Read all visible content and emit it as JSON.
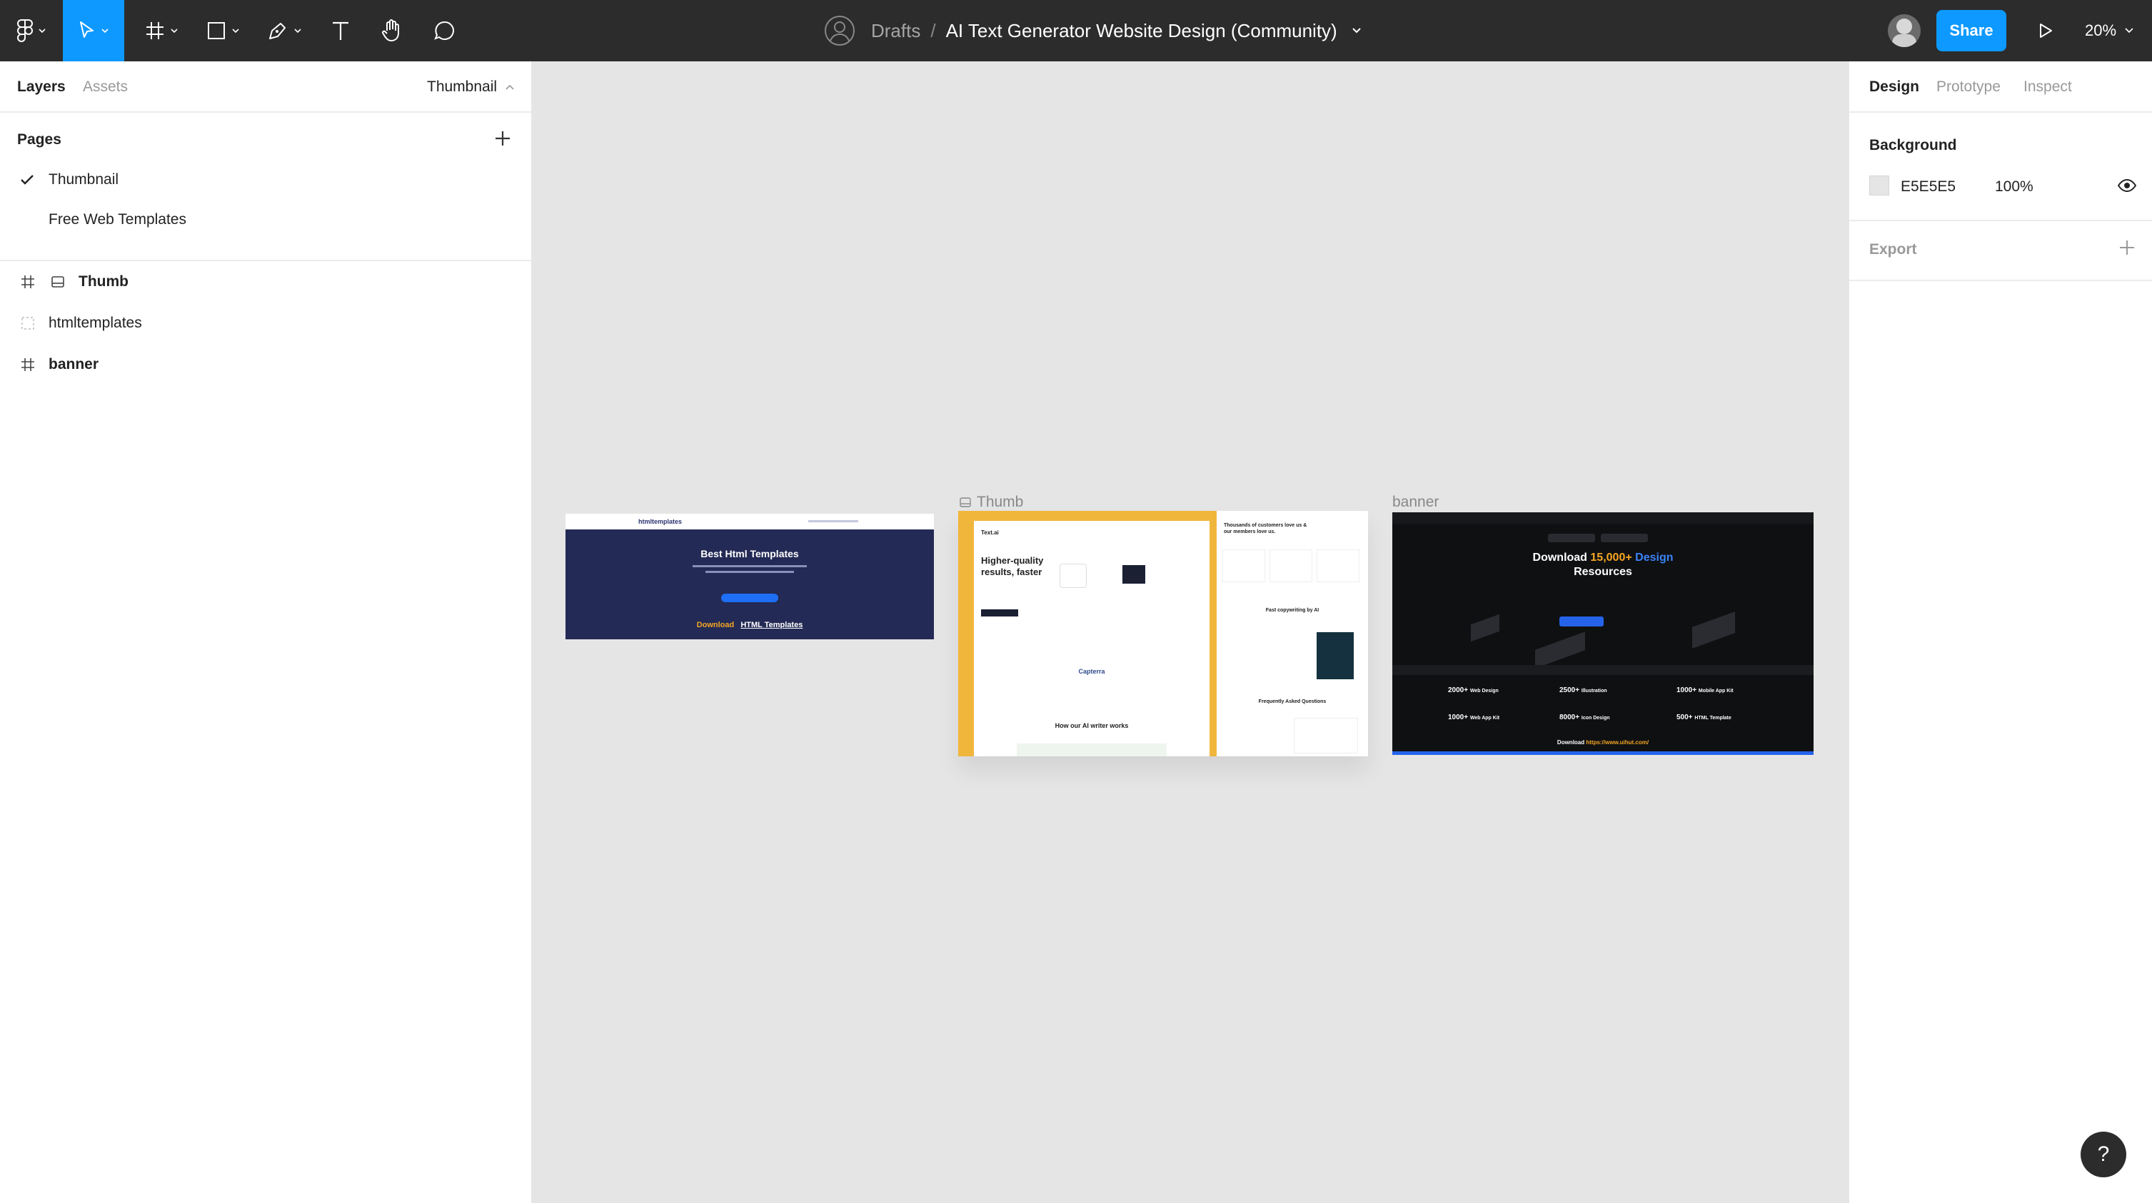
{
  "toolbar": {
    "breadcrumb_root": "Drafts",
    "separator": "/",
    "file_name": "AI Text Generator Website Design (Community)",
    "share_label": "Share",
    "zoom": "20%"
  },
  "left_panel": {
    "tabs": {
      "layers": "Layers",
      "assets": "Assets"
    },
    "current_page": "Thumbnail",
    "pages_title": "Pages",
    "pages": [
      "Thumbnail",
      "Free Web Templates"
    ],
    "layers": [
      {
        "name": "Thumb",
        "bold": true
      },
      {
        "name": "htmltemplates",
        "bold": false
      },
      {
        "name": "banner",
        "bold": true
      }
    ]
  },
  "right_panel": {
    "tabs": {
      "design": "Design",
      "prototype": "Prototype",
      "inspect": "Inspect"
    },
    "background_title": "Background",
    "background_hex": "E5E5E5",
    "background_opacity": "100%",
    "export_label": "Export"
  },
  "canvas": {
    "thumb_label": "Thumb",
    "banner_label": "banner",
    "htmltemplates": {
      "brand": "htmltemplates",
      "title": "Best Html Templates",
      "cta_word": "Download",
      "cta_link": "HTML Templates"
    },
    "thumb": {
      "logo": "Text.ai",
      "hero": "Higher-quality results, faster",
      "testimonial_head": "Thousands of customers love us & our members love us.",
      "copy_title": "Fast copywriting by AI",
      "capterra": "Capterra",
      "how_title": "How our AI writer works",
      "faq_title": "Frequently Asked Questions"
    },
    "banner": {
      "title_pre": "Download",
      "title_num": "15,000+",
      "title_word": "Design",
      "title_line2": "Resources",
      "stats": [
        {
          "num": "2000+",
          "label": "Web Design"
        },
        {
          "num": "2500+",
          "label": "Illustration"
        },
        {
          "num": "1000+",
          "label": "Mobile App Kit"
        },
        {
          "num": "1000+",
          "label": "Web App Kit"
        },
        {
          "num": "8000+",
          "label": "Icon Design"
        },
        {
          "num": "500+",
          "label": "HTML Template"
        }
      ],
      "footer_pre": "Download",
      "footer_link": "https://www.uihut.com/"
    }
  },
  "colors": {
    "accent": "#0d99ff",
    "toolbar": "#2c2c2c",
    "canvas": "#e5e5e5",
    "thumb_yellow": "#f0b63c",
    "html_navy": "#232a55",
    "banner_dark": "#0f1012",
    "orange": "#f5a623"
  }
}
